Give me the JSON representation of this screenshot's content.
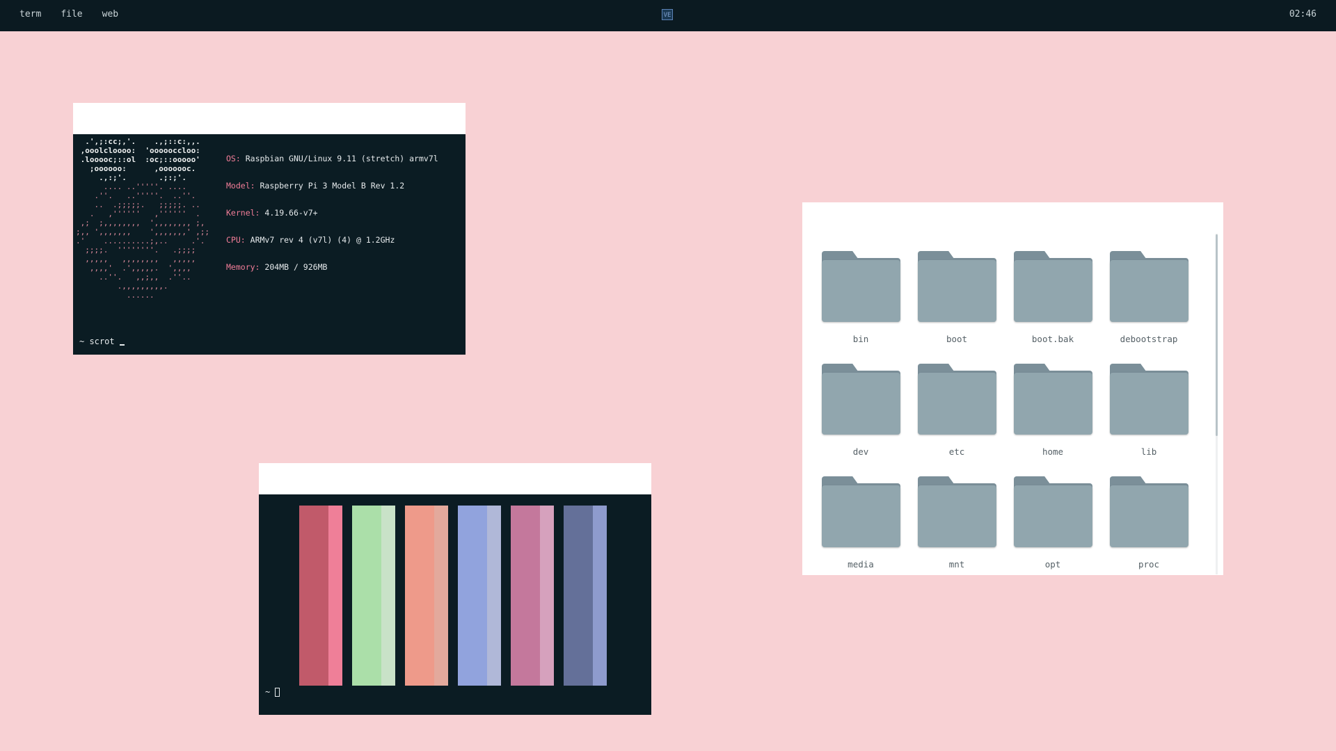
{
  "topbar": {
    "menu": [
      "term",
      "file",
      "web"
    ],
    "workspace_badge": "VE",
    "clock": "02:46"
  },
  "terminal1": {
    "sysinfo": [
      {
        "key": "OS",
        "value": "Raspbian GNU/Linux 9.11 (stretch) armv7l"
      },
      {
        "key": "Model",
        "value": "Raspberry Pi 3 Model B Rev 1.2"
      },
      {
        "key": "Kernel",
        "value": "4.19.66-v7+"
      },
      {
        "key": "CPU",
        "value": "ARMv7 rev 4 (v7l) (4) @ 1.2GHz"
      },
      {
        "key": "Memory",
        "value": "204MB / 926MB"
      }
    ],
    "prompt": "~ scrot"
  },
  "terminal2": {
    "color_pairs": [
      {
        "normal": "#c15a6a",
        "bright": "#ef7f98"
      },
      {
        "normal": "#abdfa9",
        "bright": "#c9e2c8"
      },
      {
        "normal": "#ee9a8a",
        "bright": "#e3a99c"
      },
      {
        "normal": "#91a3dd",
        "bright": "#b0b8d8"
      },
      {
        "normal": "#c4789c",
        "bright": "#d6a1bd"
      },
      {
        "normal": "#647099",
        "bright": "#8e9bcd"
      }
    ],
    "prompt": "~"
  },
  "file_manager": {
    "folders": [
      "bin",
      "boot",
      "boot.bak",
      "debootstrap",
      "dev",
      "etc",
      "home",
      "lib",
      "media",
      "mnt",
      "opt",
      "proc"
    ]
  },
  "icons": {
    "folder": "folder-icon",
    "cursor": "text-cursor"
  },
  "colors": {
    "desktop": "#f8d1d4",
    "panel": "#0b1a21",
    "terminal_bg": "#0b1c23",
    "info_key": "#f27d98",
    "folder": "#91a6ae"
  }
}
